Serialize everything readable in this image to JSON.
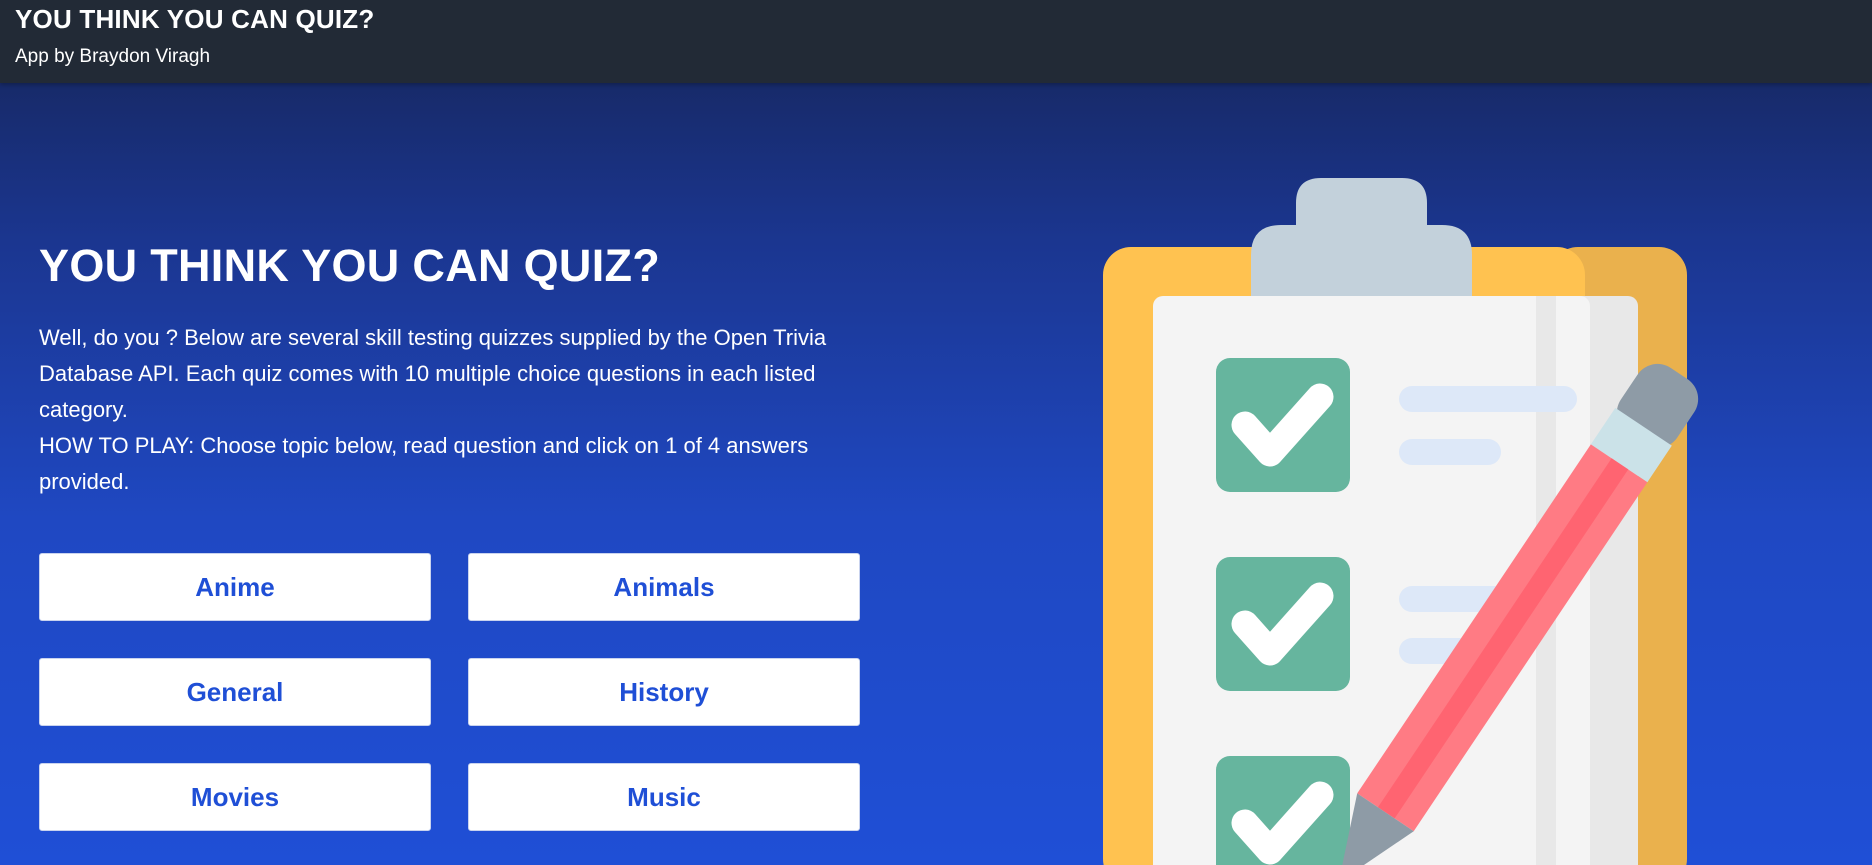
{
  "header": {
    "title": "YOU THINK YOU CAN QUIZ?",
    "subtitle": "App by Braydon Viragh"
  },
  "hero": {
    "title": "YOU THINK YOU CAN QUIZ?",
    "description": "Well, do you ? Below are several skill testing quizzes supplied by the Open Trivia Database API. Each quiz comes with 10 multiple choice questions in each listed category.",
    "how_to_play": "HOW TO PLAY: Choose topic below, read question and click on 1 of 4 answers provided."
  },
  "topics": [
    "Anime",
    "Animals",
    "General",
    "History",
    "Movies",
    "Music"
  ],
  "illustration": {
    "name": "clipboard-checklist-with-pencil",
    "colors": {
      "board": "#ffc250",
      "board_shadow": "#eab14d",
      "clip": "#c3d1db",
      "paper": "#f4f4f4",
      "paper_shadow": "#e8e8e8",
      "check_box": "#66b59e",
      "line": "#dde8f8",
      "pencil_body": "#ff7b84",
      "pencil_stripe": "#ff6471",
      "pencil_ferrule": "#cbe2e8",
      "pencil_eraser": "#8e9ba6"
    }
  },
  "colors": {
    "topbar_bg": "#222a36",
    "accent": "#1f4fd6",
    "bg_top": "#152456",
    "bg_bottom": "#1f4fd6"
  }
}
